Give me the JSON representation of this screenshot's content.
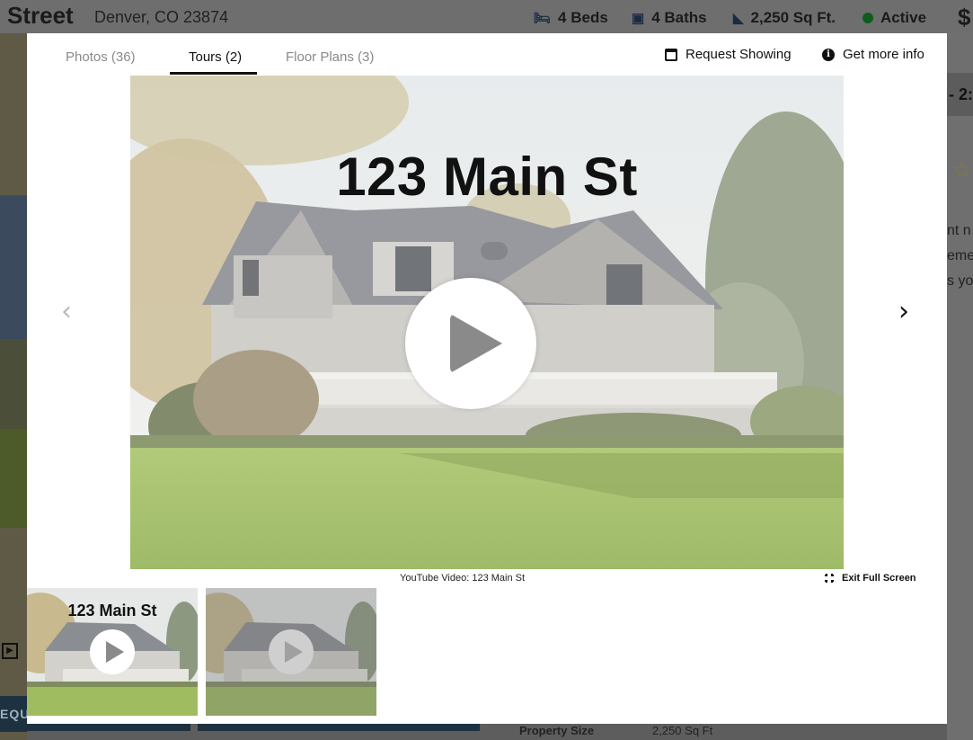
{
  "header": {
    "street": "Street",
    "city": "Denver, CO 23874",
    "beds": "4 Beds",
    "baths": "4 Baths",
    "sqft": "2,250 Sq Ft.",
    "status": "Active",
    "price_prefix": "$"
  },
  "background": {
    "right_band": "- 2:",
    "right_text_lines": [
      "nt n",
      "eme",
      "s you"
    ],
    "left_button": "EQU",
    "property_label": "Property Size",
    "property_value": "2,250 Sq Ft"
  },
  "modal": {
    "tabs": [
      {
        "label": "Photos (36)",
        "active": false
      },
      {
        "label": "Tours (2)",
        "active": true
      },
      {
        "label": "Floor Plans (3)",
        "active": false
      }
    ],
    "request_showing": "Request Showing",
    "get_more_info": "Get more info",
    "video_title": "123 Main St",
    "caption": "YouTube Video: 123 Main St",
    "exit_fullscreen": "Exit Full Screen",
    "thumbnails": [
      {
        "title": "123 Main St",
        "selected": true
      },
      {
        "title": "",
        "selected": false
      }
    ]
  },
  "colors": {
    "status_dot": "#0f5d1b",
    "navy_button": "#1e3140",
    "tab_active": "#111111",
    "tab_inactive": "#8a8a8a"
  },
  "icons": [
    "bed-icon",
    "bath-icon",
    "ruler-icon",
    "status-dot-icon",
    "calendar-icon",
    "info-icon",
    "play-icon",
    "chevron-left-icon",
    "chevron-right-icon",
    "exit-fullscreen-icon"
  ]
}
